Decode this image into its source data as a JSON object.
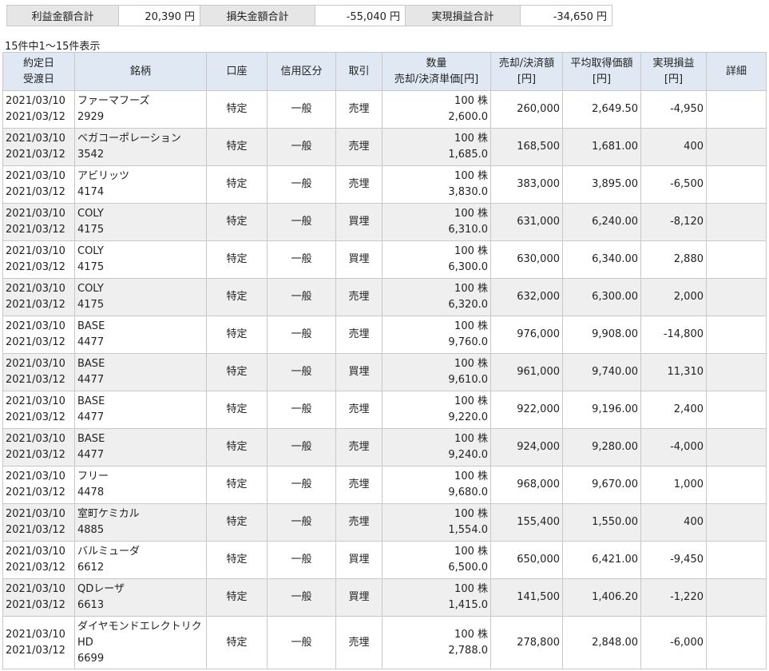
{
  "summary": {
    "profit_label": "利益金額合計",
    "profit_value": "20,390 円",
    "loss_label": "損失金額合計",
    "loss_value": "-55,040 円",
    "net_label": "実現損益合計",
    "net_value": "-34,650 円"
  },
  "count_text": "15件中1～15件表示",
  "headers": {
    "date_contract": "約定日",
    "date_delivery": "受渡日",
    "stock": "銘柄",
    "account": "口座",
    "credit": "信用区分",
    "trade": "取引",
    "qty": "数量",
    "unit_price": "売却/決済単価[円]",
    "amount": "売却/決済額",
    "amount_unit": "[円]",
    "avg": "平均取得価額",
    "avg_unit": "[円]",
    "pl": "実現損益",
    "pl_unit": "[円]",
    "detail": "詳細"
  },
  "rows": [
    {
      "contract": "2021/03/10",
      "delivery": "2021/03/12",
      "name": "ファーマフーズ",
      "code": "2929",
      "account": "特定",
      "credit": "一般",
      "trade": "売埋",
      "qty": "100 株",
      "price": "2,600.0",
      "amount": "260,000",
      "avg": "2,649.50",
      "pl": "-4,950"
    },
    {
      "contract": "2021/03/10",
      "delivery": "2021/03/12",
      "name": "ベガコーポレーション",
      "code": "3542",
      "account": "特定",
      "credit": "一般",
      "trade": "売埋",
      "qty": "100 株",
      "price": "1,685.0",
      "amount": "168,500",
      "avg": "1,681.00",
      "pl": "400"
    },
    {
      "contract": "2021/03/10",
      "delivery": "2021/03/12",
      "name": "アビリッツ",
      "code": "4174",
      "account": "特定",
      "credit": "一般",
      "trade": "売埋",
      "qty": "100 株",
      "price": "3,830.0",
      "amount": "383,000",
      "avg": "3,895.00",
      "pl": "-6,500"
    },
    {
      "contract": "2021/03/10",
      "delivery": "2021/03/12",
      "name": "COLY",
      "code": "4175",
      "account": "特定",
      "credit": "一般",
      "trade": "買埋",
      "qty": "100 株",
      "price": "6,310.0",
      "amount": "631,000",
      "avg": "6,240.00",
      "pl": "-8,120"
    },
    {
      "contract": "2021/03/10",
      "delivery": "2021/03/12",
      "name": "COLY",
      "code": "4175",
      "account": "特定",
      "credit": "一般",
      "trade": "買埋",
      "qty": "100 株",
      "price": "6,300.0",
      "amount": "630,000",
      "avg": "6,340.00",
      "pl": "2,880"
    },
    {
      "contract": "2021/03/10",
      "delivery": "2021/03/12",
      "name": "COLY",
      "code": "4175",
      "account": "特定",
      "credit": "一般",
      "trade": "売埋",
      "qty": "100 株",
      "price": "6,320.0",
      "amount": "632,000",
      "avg": "6,300.00",
      "pl": "2,000"
    },
    {
      "contract": "2021/03/10",
      "delivery": "2021/03/12",
      "name": "BASE",
      "code": "4477",
      "account": "特定",
      "credit": "一般",
      "trade": "売埋",
      "qty": "100 株",
      "price": "9,760.0",
      "amount": "976,000",
      "avg": "9,908.00",
      "pl": "-14,800"
    },
    {
      "contract": "2021/03/10",
      "delivery": "2021/03/12",
      "name": "BASE",
      "code": "4477",
      "account": "特定",
      "credit": "一般",
      "trade": "買埋",
      "qty": "100 株",
      "price": "9,610.0",
      "amount": "961,000",
      "avg": "9,740.00",
      "pl": "11,310"
    },
    {
      "contract": "2021/03/10",
      "delivery": "2021/03/12",
      "name": "BASE",
      "code": "4477",
      "account": "特定",
      "credit": "一般",
      "trade": "売埋",
      "qty": "100 株",
      "price": "9,220.0",
      "amount": "922,000",
      "avg": "9,196.00",
      "pl": "2,400"
    },
    {
      "contract": "2021/03/10",
      "delivery": "2021/03/12",
      "name": "BASE",
      "code": "4477",
      "account": "特定",
      "credit": "一般",
      "trade": "売埋",
      "qty": "100 株",
      "price": "9,240.0",
      "amount": "924,000",
      "avg": "9,280.00",
      "pl": "-4,000"
    },
    {
      "contract": "2021/03/10",
      "delivery": "2021/03/12",
      "name": "フリー",
      "code": "4478",
      "account": "特定",
      "credit": "一般",
      "trade": "売埋",
      "qty": "100 株",
      "price": "9,680.0",
      "amount": "968,000",
      "avg": "9,670.00",
      "pl": "1,000"
    },
    {
      "contract": "2021/03/10",
      "delivery": "2021/03/12",
      "name": "室町ケミカル",
      "code": "4885",
      "account": "特定",
      "credit": "一般",
      "trade": "売埋",
      "qty": "100 株",
      "price": "1,554.0",
      "amount": "155,400",
      "avg": "1,550.00",
      "pl": "400"
    },
    {
      "contract": "2021/03/10",
      "delivery": "2021/03/12",
      "name": "バルミューダ",
      "code": "6612",
      "account": "特定",
      "credit": "一般",
      "trade": "買埋",
      "qty": "100 株",
      "price": "6,500.0",
      "amount": "650,000",
      "avg": "6,421.00",
      "pl": "-9,450"
    },
    {
      "contract": "2021/03/10",
      "delivery": "2021/03/12",
      "name": "QDレーザ",
      "code": "6613",
      "account": "特定",
      "credit": "一般",
      "trade": "買埋",
      "qty": "100 株",
      "price": "1,415.0",
      "amount": "141,500",
      "avg": "1,406.20",
      "pl": "-1,220"
    },
    {
      "contract": "2021/03/10",
      "delivery": "2021/03/12",
      "name": "ダイヤモンドエレクトリクHD",
      "code": "6699",
      "account": "特定",
      "credit": "一般",
      "trade": "売埋",
      "qty": "100 株",
      "price": "2,788.0",
      "amount": "278,800",
      "avg": "2,848.00",
      "pl": "-6,000"
    }
  ]
}
